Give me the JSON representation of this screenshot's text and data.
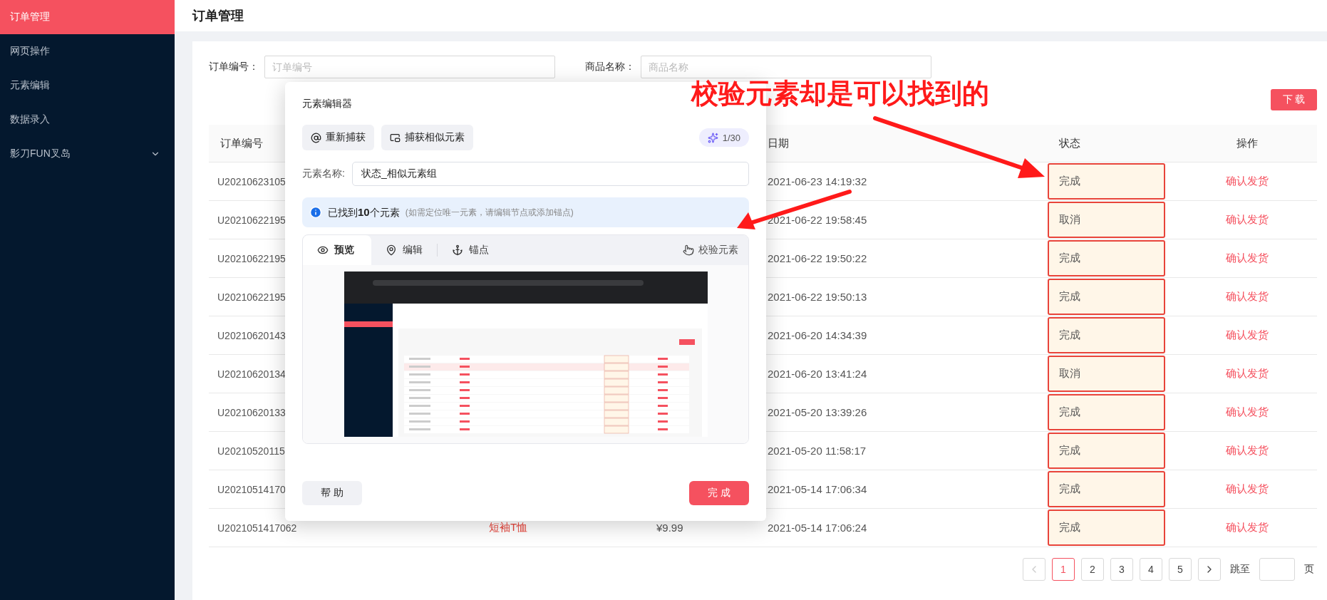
{
  "sidebar": {
    "items": [
      {
        "label": "订单管理",
        "selected": true,
        "expandable": false
      },
      {
        "label": "网页操作",
        "selected": false,
        "expandable": false
      },
      {
        "label": "元素编辑",
        "selected": false,
        "expandable": false
      },
      {
        "label": "数据录入",
        "selected": false,
        "expandable": false
      },
      {
        "label": "影刀FUN叉岛",
        "selected": false,
        "expandable": true
      }
    ]
  },
  "page": {
    "title": "订单管理"
  },
  "filters": [
    {
      "label": "订单编号：",
      "placeholder": "订单编号"
    },
    {
      "label": "商品名称：",
      "placeholder": "商品名称"
    }
  ],
  "download_button": "下 载",
  "table": {
    "columns": [
      {
        "label": "订单编号"
      },
      {
        "label": "日期"
      },
      {
        "label": "状态"
      },
      {
        "label": "操作"
      }
    ],
    "rows": [
      {
        "order": "U20210623105",
        "date": "2021-06-23 14:19:32",
        "status": "完成",
        "highlighted": true,
        "action": "确认发货"
      },
      {
        "order": "U20210622195",
        "date": "2021-06-22 19:58:45",
        "status": "取消",
        "highlighted": true,
        "action": "确认发货"
      },
      {
        "order": "U20210622195",
        "date": "2021-06-22 19:50:22",
        "status": "完成",
        "highlighted": true,
        "action": "确认发货"
      },
      {
        "order": "U20210622195",
        "date": "2021-06-22 19:50:13",
        "status": "完成",
        "highlighted": true,
        "action": "确认发货"
      },
      {
        "order": "U20210620143",
        "date": "2021-06-20 14:34:39",
        "status": "完成",
        "highlighted": true,
        "action": "确认发货"
      },
      {
        "order": "U20210620134",
        "date": "2021-06-20 13:41:24",
        "status": "取消",
        "highlighted": true,
        "action": "确认发货"
      },
      {
        "order": "U20210620133",
        "date": "2021-05-20 13:39:26",
        "status": "完成",
        "highlighted": true,
        "action": "确认发货"
      },
      {
        "order": "U20210520115",
        "date": "2021-05-20 11:58:17",
        "status": "完成",
        "highlighted": true,
        "action": "确认发货"
      },
      {
        "order": "U20210514170",
        "date": "2021-05-14 17:06:34",
        "status": "完成",
        "highlighted": true,
        "action": "确认发货"
      },
      {
        "order": "U2021051417062",
        "product": "短袖T恤",
        "price": "¥9.99",
        "date": "2021-05-14 17:06:24",
        "status": "完成",
        "highlighted": true,
        "action": "确认发货"
      }
    ]
  },
  "pagination": {
    "prev_disabled": true,
    "pages": [
      {
        "label": "1",
        "selected": true
      },
      {
        "label": "2",
        "selected": false
      },
      {
        "label": "3",
        "selected": false
      },
      {
        "label": "4",
        "selected": false
      },
      {
        "label": "5",
        "selected": false
      }
    ],
    "jump_label": "跳至",
    "page_suffix": "页"
  },
  "modal": {
    "title": "元素编辑器",
    "actions": [
      {
        "kind": "recapture",
        "label": "重新捕获"
      },
      {
        "kind": "similar",
        "label": "捕获相似元素"
      }
    ],
    "quota": "1/30",
    "name_field": {
      "label": "元素名称:",
      "value": "状态_相似元素组"
    },
    "info": {
      "text": "已找到**10**个元素",
      "hint": "(如需定位唯一元素，请编辑节点或添加锚点)"
    },
    "tabs": [
      {
        "kind": "preview",
        "label": "预览",
        "selected": true
      },
      {
        "kind": "edit",
        "label": "编辑",
        "selected": false
      },
      {
        "kind": "anchor",
        "label": "锚点",
        "selected": false
      }
    ],
    "verify_button": "校验元素",
    "help_button": "帮 助",
    "done_button": "完 成"
  },
  "annotation": {
    "text": "校验元素却是可以找到的"
  }
}
